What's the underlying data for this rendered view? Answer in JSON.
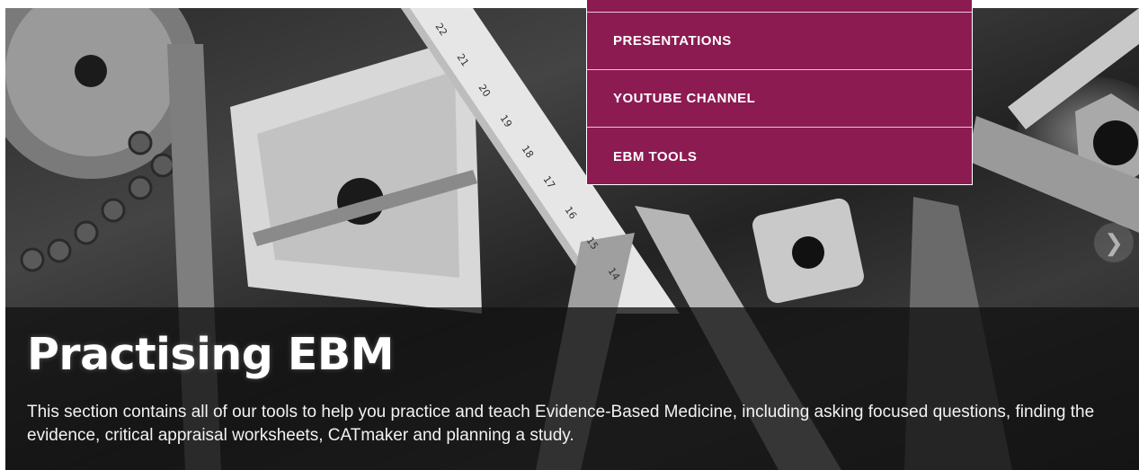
{
  "hero": {
    "title": "Practising EBM",
    "description": "This section contains all of our tools to help you practice and teach Evidence-Based Medicine, including asking focused questions, finding the evidence, critical appraisal worksheets, CATmaker and planning a study."
  },
  "menu": {
    "items": [
      {
        "label": "PRESENTATIONS"
      },
      {
        "label": "YOUTUBE CHANNEL"
      },
      {
        "label": "EBM TOOLS"
      }
    ]
  },
  "ruler": {
    "ticks": [
      "22",
      "21",
      "20",
      "19",
      "18",
      "17",
      "16",
      "15",
      "14"
    ]
  },
  "icons": {
    "next": "chevron-right-icon"
  },
  "colors": {
    "menu_background": "#8c1b52",
    "caption_overlay": "#121212"
  }
}
